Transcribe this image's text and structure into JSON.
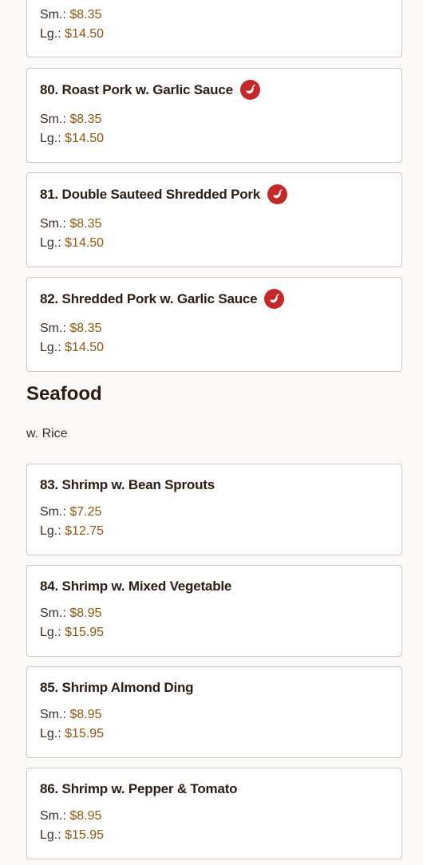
{
  "colors": {
    "background": "#faf9f7",
    "card_border": "#cbc7c3",
    "price": "#8a5a12",
    "spicy_icon": "#c62828"
  },
  "items_top": [
    {
      "name": "",
      "spicy": false,
      "small_label": "Sm.:",
      "small_price": "$8.35",
      "large_label": "Lg.:",
      "large_price": "$14.50"
    },
    {
      "name": "80. Roast Pork w. Garlic Sauce",
      "spicy": true,
      "small_label": "Sm.:",
      "small_price": "$8.35",
      "large_label": "Lg.:",
      "large_price": "$14.50"
    },
    {
      "name": "81. Double Sauteed Shredded Pork",
      "spicy": true,
      "small_label": "Sm.:",
      "small_price": "$8.35",
      "large_label": "Lg.:",
      "large_price": "$14.50"
    },
    {
      "name": "82. Shredded Pork w. Garlic Sauce",
      "spicy": true,
      "small_label": "Sm.:",
      "small_price": "$8.35",
      "large_label": "Lg.:",
      "large_price": "$14.50"
    }
  ],
  "section": {
    "title": "Seafood",
    "note": "w. Rice"
  },
  "items_seafood": [
    {
      "name": "83. Shrimp w. Bean Sprouts",
      "spicy": false,
      "small_label": "Sm.:",
      "small_price": "$7.25",
      "large_label": "Lg.:",
      "large_price": "$12.75"
    },
    {
      "name": "84. Shrimp w. Mixed Vegetable",
      "spicy": false,
      "small_label": "Sm.:",
      "small_price": "$8.95",
      "large_label": "Lg.:",
      "large_price": "$15.95"
    },
    {
      "name": "85. Shrimp Almond Ding",
      "spicy": false,
      "small_label": "Sm.:",
      "small_price": "$8.95",
      "large_label": "Lg.:",
      "large_price": "$15.95"
    },
    {
      "name": "86. Shrimp w. Pepper & Tomato",
      "spicy": false,
      "small_label": "Sm.:",
      "small_price": "$8.95",
      "large_label": "Lg.:",
      "large_price": "$15.95"
    }
  ]
}
